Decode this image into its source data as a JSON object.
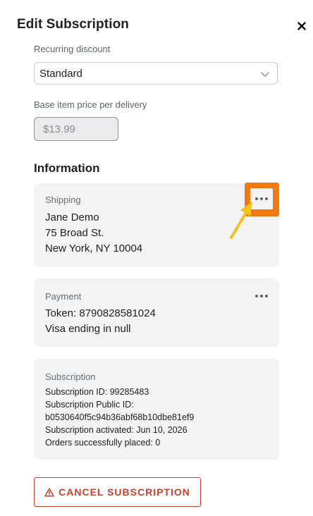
{
  "header": {
    "title": "Edit Subscription",
    "close_icon": "close-icon"
  },
  "form": {
    "recurring_discount": {
      "label": "Recurring discount",
      "value": "Standard"
    },
    "base_price": {
      "label": "Base item price per delivery",
      "value": "$13.99"
    }
  },
  "information": {
    "title": "Information",
    "shipping": {
      "title": "Shipping",
      "name": "Jane Demo",
      "street": "75 Broad St.",
      "city_line": "New York, NY 10004"
    },
    "payment": {
      "title": "Payment",
      "token": "Token: 8790828581024",
      "card": "Visa ending in null"
    },
    "subscription": {
      "title": "Subscription",
      "id": "Subscription ID: 99285483",
      "public_id_label": "Subscription Public ID:",
      "public_id": "b0530640f5c94b36abf68b10dbe81ef9",
      "activated": "Subscription activated: Jun 10, 2026",
      "orders": "Orders successfully placed: 0"
    }
  },
  "actions": {
    "cancel_label": "CANCEL SUBSCRIPTION"
  },
  "colors": {
    "accent_highlight": "#f07a12",
    "arrow": "#f4c21a",
    "danger": "#c8412f",
    "card_bg": "#f3f3f3"
  }
}
